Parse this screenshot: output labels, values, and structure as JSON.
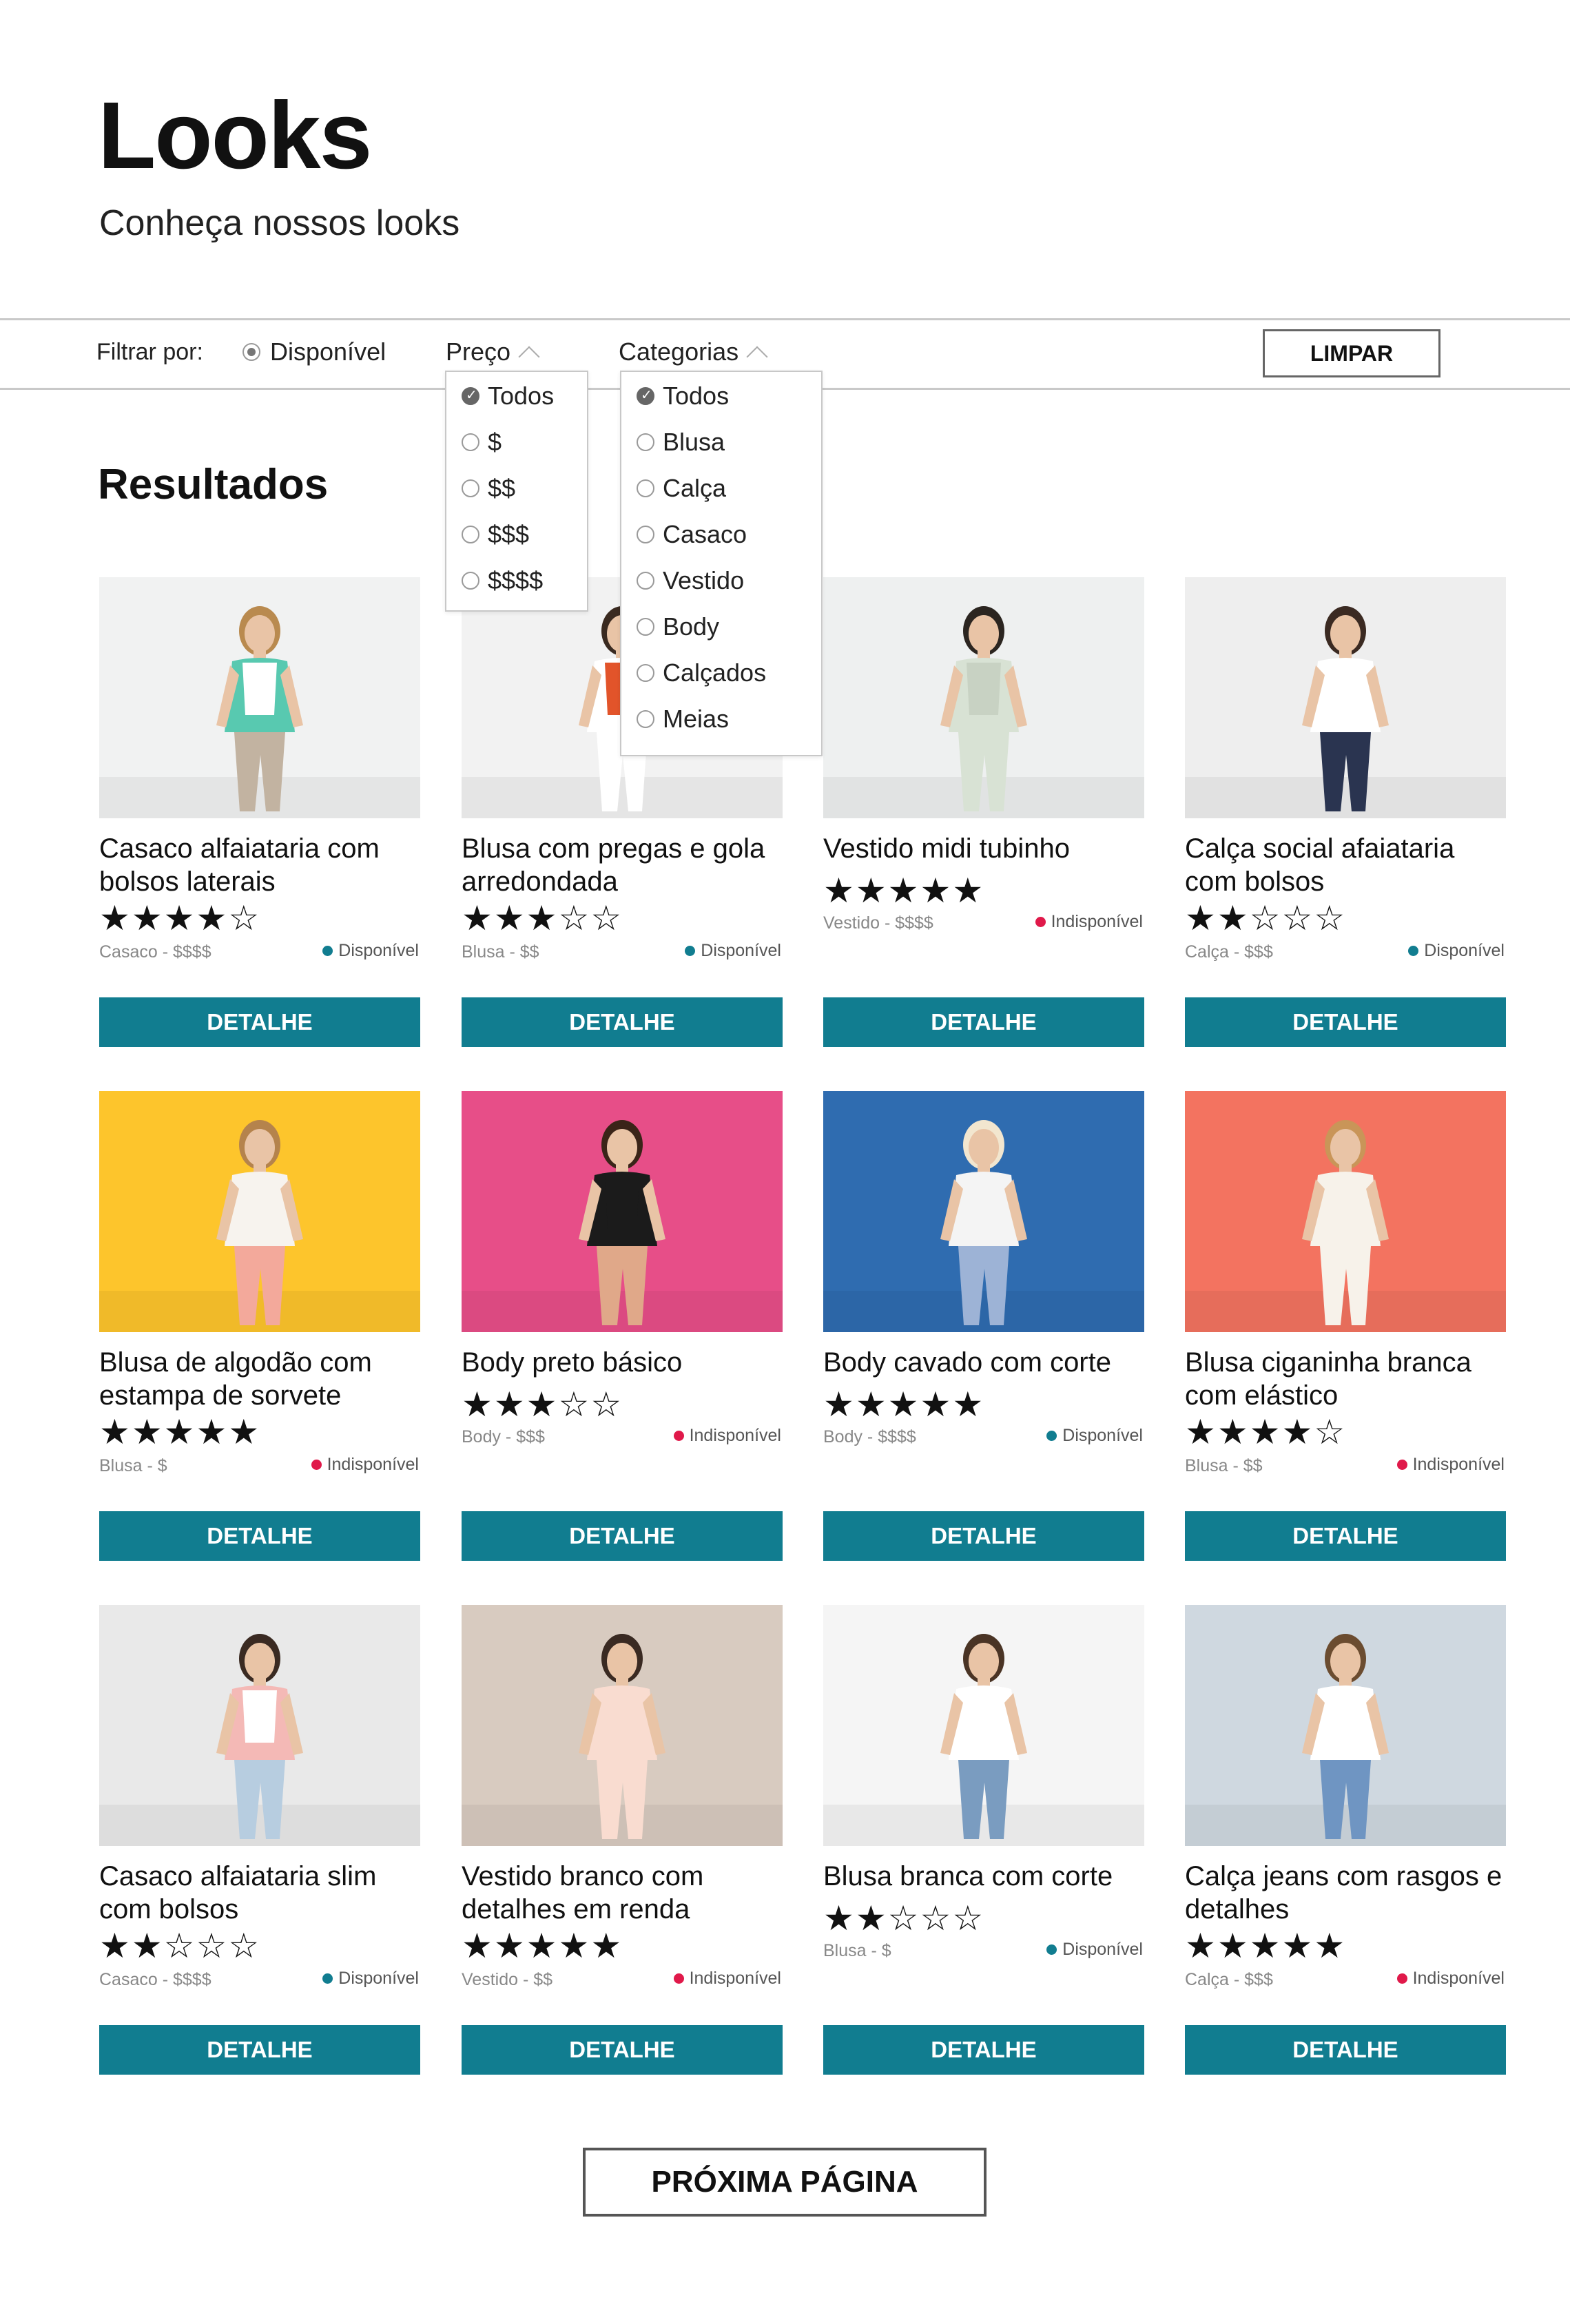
{
  "header": {
    "title": "Looks",
    "subtitle": "Conheça nossos looks"
  },
  "filters": {
    "label": "Filtrar por:",
    "availability": "Disponível",
    "price": {
      "label": "Preço",
      "options": [
        "Todos",
        "$",
        "$$",
        "$$$",
        "$$$$"
      ],
      "selected": "Todos"
    },
    "categories": {
      "label": "Categorias",
      "options": [
        "Todos",
        "Blusa",
        "Calça",
        "Casaco",
        "Vestido",
        "Body",
        "Calçados",
        "Meias"
      ],
      "selected": "Todos"
    },
    "clear_label": "LIMPAR"
  },
  "results_title": "Resultados",
  "detail_label": "DETALHE",
  "next_page_label": "PRÓXIMA PÁGINA",
  "colors": {
    "accent": "#117d90",
    "available": "#117d90",
    "unavailable": "#e0194a"
  },
  "products": [
    {
      "name": "Casaco alfaiataria com bolsos laterais",
      "rating": 4,
      "meta": "Casaco - $$$$",
      "status": "Disponível",
      "available": true
    },
    {
      "name": "Blusa com pregas e gola arredondada",
      "rating": 3,
      "meta": "Blusa - $$",
      "status": "Disponível",
      "available": true
    },
    {
      "name": "Vestido midi tubinho",
      "rating": 5,
      "meta": "Vestido - $$$$",
      "status": "Indisponível",
      "available": false
    },
    {
      "name": "Calça social afaiataria com bolsos",
      "rating": 2,
      "meta": "Calça - $$$",
      "status": "Disponível",
      "available": true
    },
    {
      "name": "Blusa de algodão com estampa de sorvete",
      "rating": 5,
      "meta": "Blusa - $",
      "status": "Indisponível",
      "available": false
    },
    {
      "name": "Body preto básico",
      "rating": 3,
      "meta": "Body - $$$",
      "status": "Indisponível",
      "available": false
    },
    {
      "name": "Body cavado com corte",
      "rating": 5,
      "meta": "Body - $$$$",
      "status": "Disponível",
      "available": true
    },
    {
      "name": "Blusa ciganinha branca com elástico",
      "rating": 4,
      "meta": "Blusa - $$",
      "status": "Indisponível",
      "available": false
    },
    {
      "name": "Casaco alfaiataria slim com bolsos",
      "rating": 2,
      "meta": "Casaco - $$$$",
      "status": "Disponível",
      "available": true
    },
    {
      "name": "Vestido branco com detalhes em renda",
      "rating": 5,
      "meta": "Vestido - $$",
      "status": "Indisponível",
      "available": false
    },
    {
      "name": "Blusa branca com corte",
      "rating": 2,
      "meta": "Blusa - $",
      "status": "Disponível",
      "available": true
    },
    {
      "name": "Calça jeans com rasgos e detalhes",
      "rating": 5,
      "meta": "Calça - $$$",
      "status": "Indisponível",
      "available": false
    }
  ]
}
